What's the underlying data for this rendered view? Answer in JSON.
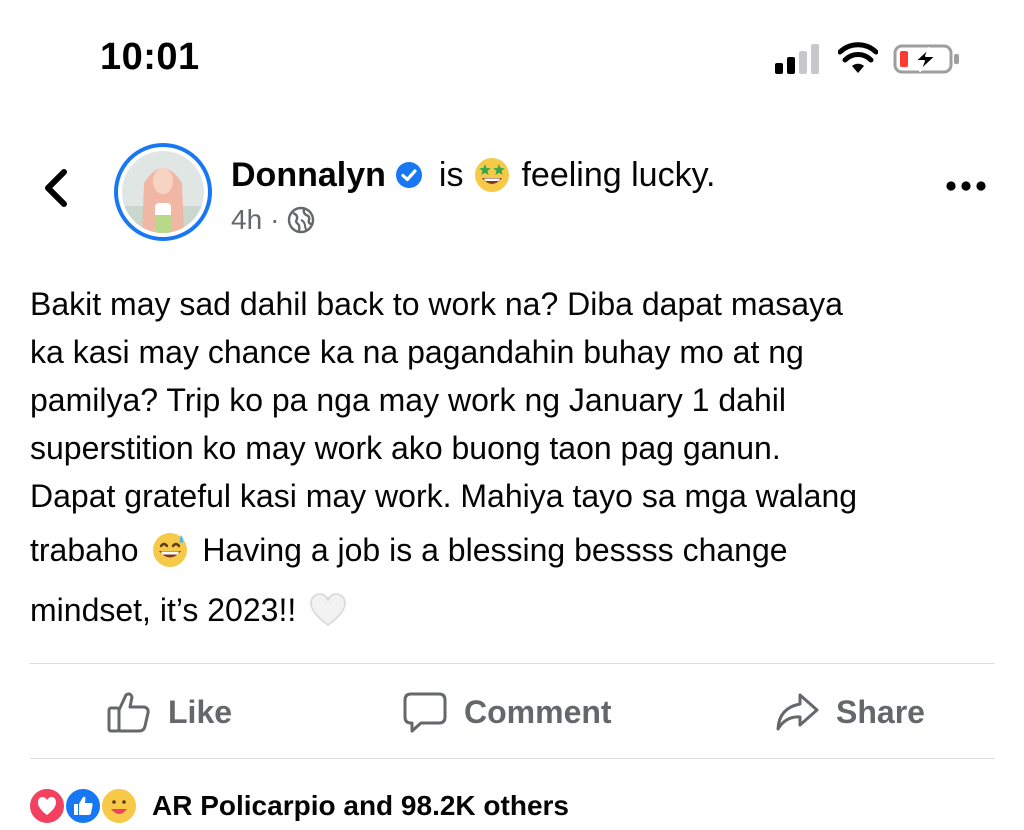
{
  "status_bar": {
    "time": "10:01",
    "battery_color": "#ff3b30"
  },
  "post": {
    "back_icon": "chevron-left-icon",
    "author": "Donnalyn",
    "verified_icon": "verified-badge-icon",
    "is_word": "is",
    "activity_emoji": "star-struck-emoji",
    "activity": "feeling lucky.",
    "time_ago": "4h",
    "separator": "·",
    "privacy_icon": "globe-icon",
    "more_icon": "more-horizontal-icon",
    "body_lines": [
      "Bakit may sad dahil back to work na? Diba dapat masaya",
      "ka kasi may chance ka na pagandahin buhay mo at ng",
      "pamilya? Trip ko pa nga may work ng January 1 dahil",
      "superstition ko may work ako buong taon pag ganun.",
      "Dapat grateful kasi may work. Mahiya tayo sa mga walang"
    ],
    "body_line6_before": "trabaho",
    "body_line6_emoji": "grinning-sweat-emoji",
    "body_line6_after": "Having a job is a blessing bessss change",
    "body_line7": "mindset, it’s 2023!!",
    "body_line7_emoji": "white-heart-emoji"
  },
  "actions": {
    "like": "Like",
    "comment": "Comment",
    "share": "Share"
  },
  "reactions": {
    "icons": [
      "love-reaction-icon",
      "like-reaction-icon",
      "care-reaction-icon"
    ],
    "summary": "AR Policarpio and 98.2K others"
  },
  "colors": {
    "brand_blue": "#1877f2",
    "secondary_text": "#65676b",
    "divider": "#dadde1"
  }
}
